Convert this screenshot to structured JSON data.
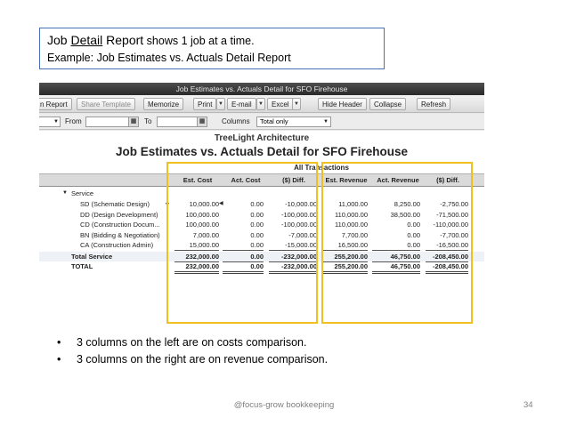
{
  "slide": {
    "title_part1": "Job ",
    "title_detail": "Detail",
    "title_part2": " Report",
    "title_tail": " shows 1 job at a time.",
    "subtitle": "Example: Job Estimates vs. Actuals Detail Report"
  },
  "window": {
    "title": "Job Estimates vs. Actuals Detail for SFO Firehouse"
  },
  "toolbar": {
    "report_btn": "n Report",
    "share_template": "Share Template",
    "memorize": "Memorize",
    "print": "Print",
    "email": "E-mail",
    "excel": "Excel",
    "hide_header": "Hide Header",
    "collapse": "Collapse",
    "refresh": "Refresh",
    "dropdown_arrow": "▼"
  },
  "filters": {
    "from_label": "From",
    "to_label": "To",
    "columns_label": "Columns",
    "columns_value": "Total only"
  },
  "report": {
    "company": "TreeLight Architecture",
    "title": "Job Estimates vs. Actuals Detail for SFO Firehouse",
    "group_header": "All Transactions",
    "headers": [
      "Est. Cost",
      "Act. Cost",
      "($) Diff.",
      "Est. Revenue",
      "Act. Revenue",
      "($) Diff."
    ],
    "section": "Service",
    "section_marker": "▼",
    "rows": [
      {
        "name": "SD (Schematic Design)",
        "values": [
          "10,000.00",
          "0.00",
          "-10,000.00",
          "11,000.00",
          "8,250.00",
          "-2,750.00"
        ]
      },
      {
        "name": "DD (Design Development)",
        "values": [
          "100,000.00",
          "0.00",
          "-100,000.00",
          "110,000.00",
          "38,500.00",
          "-71,500.00"
        ]
      },
      {
        "name": "CD (Construction Docum...",
        "values": [
          "100,000.00",
          "0.00",
          "-100,000.00",
          "110,000.00",
          "0.00",
          "-110,000.00"
        ]
      },
      {
        "name": "BN (Bidding & Negotiation)",
        "values": [
          "7,000.00",
          "0.00",
          "-7,000.00",
          "7,700.00",
          "0.00",
          "-7,700.00"
        ]
      },
      {
        "name": "CA (Construction Admin)",
        "values": [
          "15,000.00",
          "0.00",
          "-15,000.00",
          "16,500.00",
          "0.00",
          "-16,500.00"
        ]
      }
    ],
    "total_service": {
      "name": "Total Service",
      "values": [
        "232,000.00",
        "0.00",
        "-232,000.00",
        "255,200.00",
        "46,750.00",
        "-208,450.00"
      ]
    },
    "total": {
      "name": "TOTAL",
      "values": [
        "232,000.00",
        "0.00",
        "-232,000.00",
        "255,200.00",
        "46,750.00",
        "-208,450.00"
      ]
    }
  },
  "bullets": [
    "3 columns on the left are on costs comparison.",
    "3 columns on the right are on revenue comparison."
  ],
  "bullet_symbol": "•",
  "footer": {
    "brand": "@focus-grow bookkeeping",
    "page": "34"
  },
  "colors": {
    "highlight": "#f0c020",
    "title_border": "#4a6fb5"
  }
}
